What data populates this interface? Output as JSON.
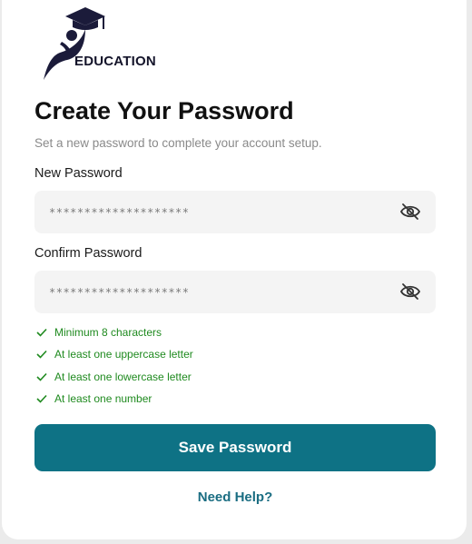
{
  "brand": {
    "logo_text": "EDUCATION",
    "logo_icon": "graduate-cap-person-icon",
    "logo_color": "#14142a"
  },
  "page": {
    "title": "Create Your Password",
    "subtitle": "Set a new password to complete your account setup."
  },
  "form": {
    "new_password": {
      "label": "New Password",
      "value": "********************",
      "toggle_icon": "eye-off-icon"
    },
    "confirm_password": {
      "label": "Confirm Password",
      "value": "********************",
      "toggle_icon": "eye-off-icon"
    }
  },
  "requirements": [
    {
      "text": "Minimum 8 characters",
      "met": true
    },
    {
      "text": "At least one uppercase letter",
      "met": true
    },
    {
      "text": "At least one lowercase letter",
      "met": true
    },
    {
      "text": "At least one number",
      "met": true
    }
  ],
  "actions": {
    "save_label": "Save Password",
    "help_label": "Need Help?"
  },
  "colors": {
    "primary": "#0e7285",
    "success": "#1f8a1f",
    "link": "#1a6d82",
    "field_bg": "#f4f4f4"
  }
}
